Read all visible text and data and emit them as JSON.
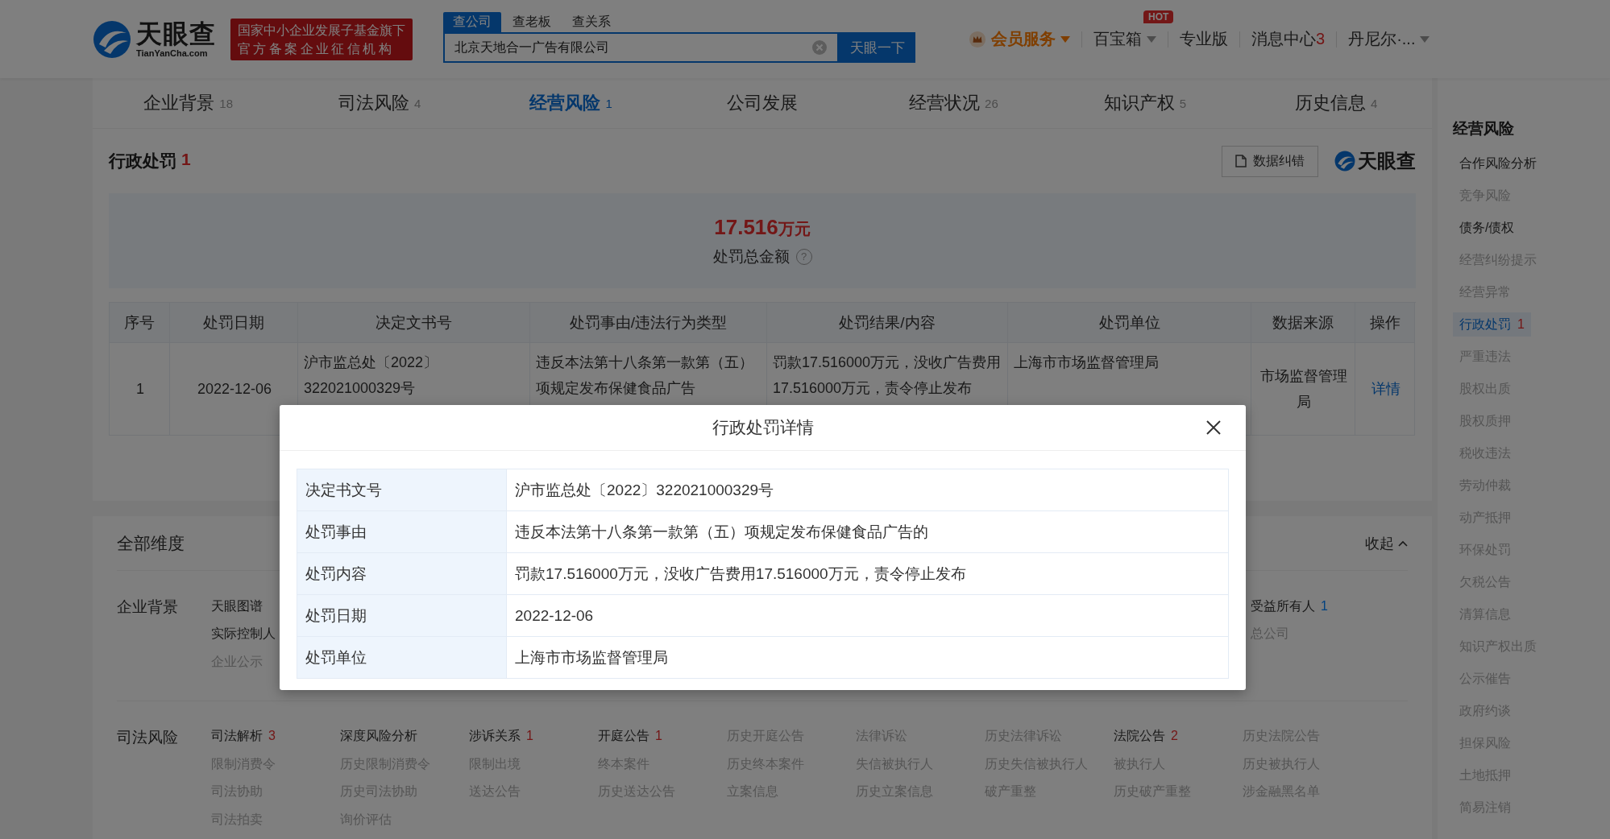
{
  "header": {
    "logo": {
      "name": "天眼查",
      "domain": "TianYanCha.com"
    },
    "badge": [
      "国家中小企业发展子基金旗下",
      "官方备案企业征信机构"
    ],
    "search": {
      "tabs": [
        {
          "label": "查公司",
          "selected": true
        },
        {
          "label": "查老板",
          "selected": false
        },
        {
          "label": "查关系",
          "selected": false
        }
      ],
      "value": "北京天地合一广告有限公司",
      "button": "天眼一下"
    },
    "nav": [
      {
        "kind": "vip",
        "label": "会员服务",
        "dropdown": true
      },
      {
        "kind": "plain",
        "label": "百宝箱",
        "dropdown": true,
        "badge": "HOT"
      },
      {
        "kind": "plain",
        "label": "专业版",
        "dropdown": false
      },
      {
        "kind": "plain",
        "label": "消息中心",
        "count": "3",
        "dropdown": false
      },
      {
        "kind": "plain",
        "label": "丹尼尔·...",
        "dropdown": true
      }
    ]
  },
  "tabs": [
    {
      "label": "企业背景",
      "count": "18",
      "selected": false
    },
    {
      "label": "司法风险",
      "count": "4",
      "selected": false
    },
    {
      "label": "经营风险",
      "count": "1",
      "selected": true
    },
    {
      "label": "公司发展",
      "selected": false
    },
    {
      "label": "经营状况",
      "count": "26",
      "selected": false
    },
    {
      "label": "知识产权",
      "count": "5",
      "selected": false
    },
    {
      "label": "历史信息",
      "count": "4",
      "selected": false
    }
  ],
  "section": {
    "title": "行政处罚",
    "count": "1",
    "correction_button": "数据纠错",
    "brand": "天眼查",
    "summary": {
      "amount": "17.516",
      "unit": "万元",
      "label": "处罚总金额",
      "help": "?"
    },
    "table": {
      "columns": [
        "序号",
        "处罚日期",
        "决定文书号",
        "处罚事由/违法行为类型",
        "处罚结果/内容",
        "处罚单位",
        "数据来源",
        "操作"
      ],
      "rows": [
        {
          "cells": [
            "1",
            "2022-12-06",
            "沪市监总处〔2022〕322021000329号",
            "违反本法第十八条第一款第（五）项规定发布保健食品广告",
            "罚款17.516000万元，没收广告费用17.516000万元，责令停止发布",
            "上海市市场监督管理局",
            "市场监督管理局"
          ],
          "action": "详情"
        }
      ]
    }
  },
  "dimensions": {
    "title": "全部维度",
    "toggle": "收起",
    "groups": [
      {
        "label": "企业背景",
        "kind": "split",
        "rows": [
          {
            "left": {
              "label": "天眼图谱",
              "active": true
            },
            "right": {
              "label": "受益所有人",
              "count": "1",
              "color": "#004280",
              "active": true
            }
          },
          {
            "left": {
              "label": "实际控制人",
              "active": true
            },
            "right": {
              "label": "总公司",
              "active": false
            }
          },
          {
            "left": {
              "label": "企业公示",
              "active": false
            }
          }
        ]
      },
      {
        "label": "司法风险",
        "kind": "grid",
        "items": [
          {
            "label": "司法解析",
            "count": "3",
            "color": "#731717",
            "active": true
          },
          {
            "label": "深度风险分析",
            "active": true
          },
          {
            "label": "涉诉关系",
            "count": "1",
            "color": "#731717",
            "active": true
          },
          {
            "label": "开庭公告",
            "count": "1",
            "color": "#731717",
            "active": true
          },
          {
            "label": "历史开庭公告",
            "active": false
          },
          {
            "label": "法律诉讼",
            "active": false
          },
          {
            "label": "历史法律诉讼",
            "active": false
          },
          {
            "label": "法院公告",
            "count": "2",
            "color": "#731717",
            "active": true
          },
          {
            "label": "历史法院公告",
            "active": false
          },
          {
            "label": "限制消费令",
            "active": false
          },
          {
            "label": "历史限制消费令",
            "active": false
          },
          {
            "label": "限制出境",
            "active": false
          },
          {
            "label": "终本案件",
            "active": false
          },
          {
            "label": "历史终本案件",
            "active": false
          },
          {
            "label": "失信被执行人",
            "active": false
          },
          {
            "label": "历史失信被执行人",
            "active": false
          },
          {
            "label": "被执行人",
            "active": false
          },
          {
            "label": "历史被执行人",
            "active": false
          },
          {
            "label": "司法协助",
            "active": false
          },
          {
            "label": "历史司法协助",
            "active": false
          },
          {
            "label": "送达公告",
            "active": false
          },
          {
            "label": "历史送达公告",
            "active": false
          },
          {
            "label": "立案信息",
            "active": false
          },
          {
            "label": "历史立案信息",
            "active": false
          },
          {
            "label": "破产重整",
            "active": false
          },
          {
            "label": "历史破产重整",
            "active": false
          },
          {
            "label": "涉金融黑名单",
            "active": false
          },
          {
            "label": "司法拍卖",
            "active": false
          },
          {
            "label": "询价评估",
            "active": false
          }
        ]
      }
    ]
  },
  "sidebar": {
    "title": "经营风险",
    "items": [
      {
        "label": "合作风险分析",
        "active": true,
        "selected": false
      },
      {
        "label": "竞争风险",
        "active": false,
        "selected": false
      },
      {
        "label": "债务/债权",
        "active": true,
        "selected": false
      },
      {
        "label": "经营纠纷提示",
        "active": false,
        "selected": false
      },
      {
        "label": "经营异常",
        "active": false,
        "selected": false
      },
      {
        "label": "行政处罚",
        "count": "1",
        "active": true,
        "selected": true
      },
      {
        "label": "严重违法",
        "active": false,
        "selected": false
      },
      {
        "label": "股权出质",
        "active": false,
        "selected": false
      },
      {
        "label": "股权质押",
        "active": false,
        "selected": false
      },
      {
        "label": "税收违法",
        "active": false,
        "selected": false
      },
      {
        "label": "劳动仲裁",
        "active": false,
        "selected": false
      },
      {
        "label": "动产抵押",
        "active": false,
        "selected": false
      },
      {
        "label": "环保处罚",
        "active": false,
        "selected": false
      },
      {
        "label": "欠税公告",
        "active": false,
        "selected": false
      },
      {
        "label": "清算信息",
        "active": false,
        "selected": false
      },
      {
        "label": "知识产权出质",
        "active": false,
        "selected": false
      },
      {
        "label": "公示催告",
        "active": false,
        "selected": false
      },
      {
        "label": "政府约谈",
        "active": false,
        "selected": false
      },
      {
        "label": "担保风险",
        "active": false,
        "selected": false
      },
      {
        "label": "土地抵押",
        "active": false,
        "selected": false
      },
      {
        "label": "简易注销",
        "active": false,
        "selected": false
      }
    ]
  },
  "dialog": {
    "title": "行政处罚详情",
    "rows": [
      {
        "label": "决定书文号",
        "value": "沪市监总处〔2022〕322021000329号"
      },
      {
        "label": "处罚事由",
        "value": "违反本法第十八条第一款第（五）项规定发布保健食品广告的"
      },
      {
        "label": "处罚内容",
        "value": "罚款17.516000万元，没收广告费用17.516000万元，责令停止发布"
      },
      {
        "label": "处罚日期",
        "value": "2022-12-06"
      },
      {
        "label": "处罚单位",
        "value": "上海市市场监督管理局"
      }
    ]
  }
}
